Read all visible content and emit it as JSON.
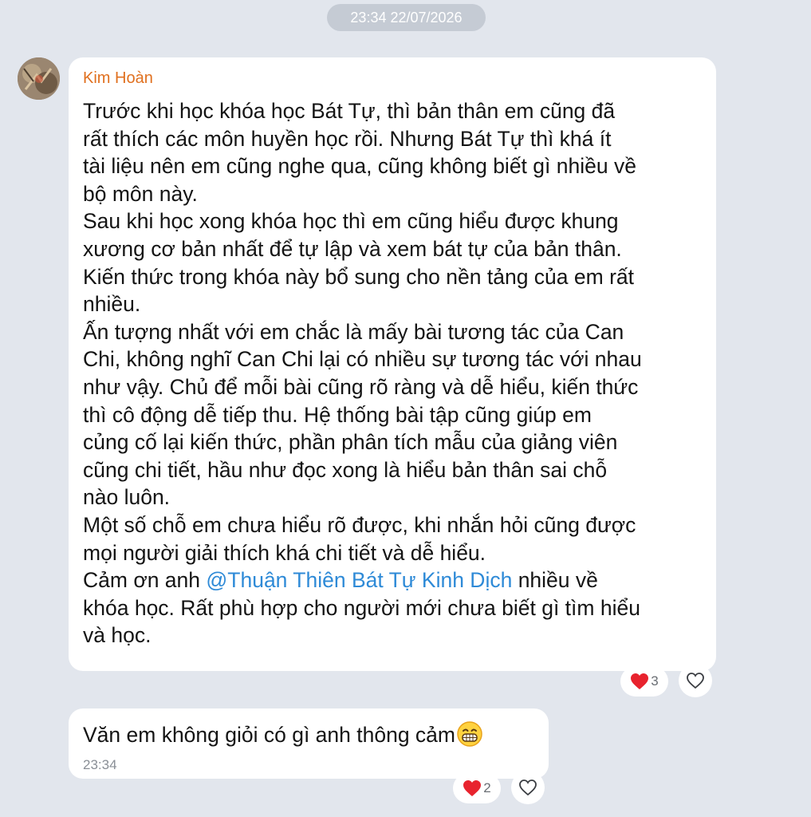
{
  "header": {
    "timestamp": "23:34 22/07/2026"
  },
  "message_1": {
    "sender": "Kim Hoàn",
    "text_before_mention": "Trước khi học khóa học Bát Tự, thì bản thân em cũng đã\nrất thích các môn huyền học rồi. Nhưng Bát Tự thì khá ít\ntài liệu nên em cũng nghe qua, cũng không biết gì nhiều về\nbộ môn này.\nSau khi học xong khóa học thì em cũng hiểu được khung\nxương cơ bản nhất để tự lập và xem bát tự của bản thân.\nKiến thức trong khóa này bổ sung cho nền tảng của em rất\nnhiều.\nẤn tượng nhất với em chắc là mấy bài tương tác của Can\nChi, không nghĩ Can Chi lại có nhiều sự tương tác với nhau\nnhư vậy. Chủ để mỗi bài cũng rõ ràng và dễ hiểu, kiến thức\nthì cô động dễ tiếp thu. Hệ thống bài tập cũng giúp em\ncủng cố lại kiến thức, phần phân tích mẫu của giảng viên\ncũng chi tiết, hầu như đọc xong là hiểu bản thân sai chỗ\nnào luôn.\nMột số chỗ em chưa hiểu rõ được, khi nhắn hỏi cũng được\nmọi người giải thích khá chi tiết và dễ hiểu.\nCảm ơn anh ",
    "mention": "@Thuận Thiên Bát Tự Kinh Dịch",
    "text_after_mention": "  nhiều về\nkhóa học. Rất phù hợp cho người mới chưa biết gì tìm hiểu\nvà học.",
    "reaction_count": "3"
  },
  "message_2": {
    "text": "Văn em không giỏi có gì anh thông cảm",
    "time": "23:34",
    "reaction_count": "2"
  },
  "icons": {
    "heart": "heart-icon",
    "like": "heart-outline-icon",
    "emoji": "grinning-face-emoji"
  },
  "colors": {
    "background": "#e2e6ed",
    "sender_name": "#e0701f",
    "mention": "#2e8ad7",
    "heart": "#e8232e"
  }
}
